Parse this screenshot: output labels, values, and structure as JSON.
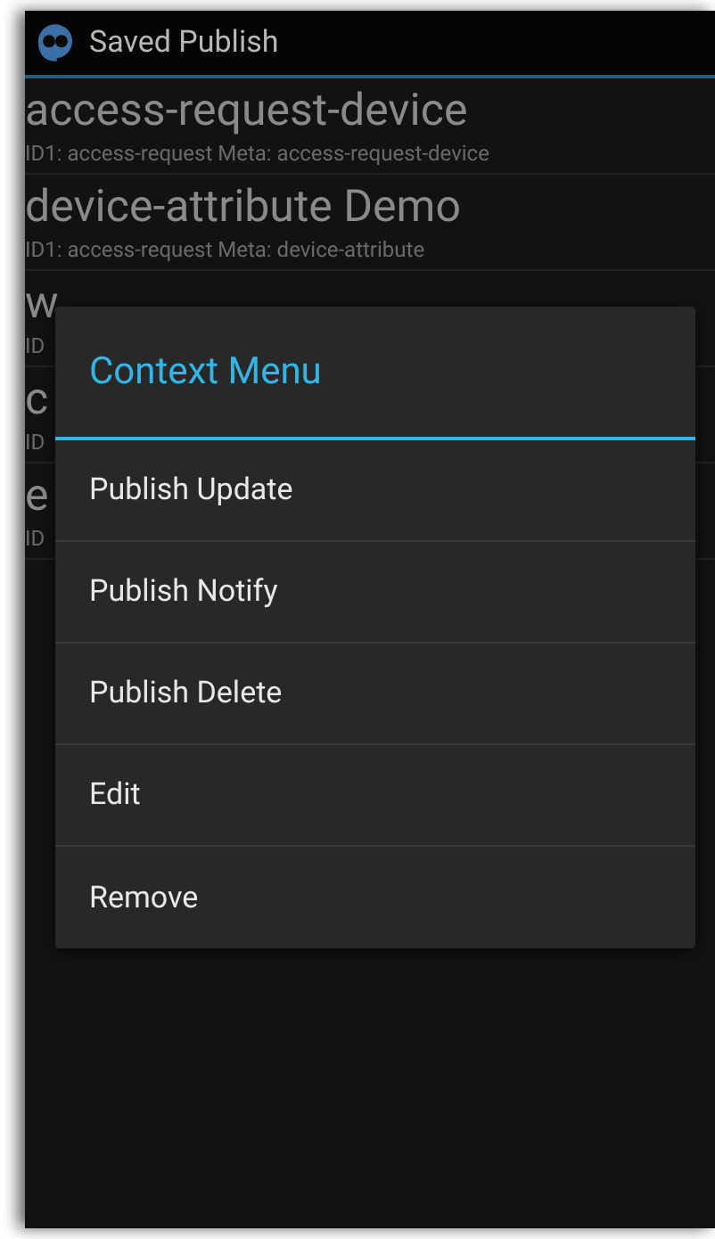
{
  "app_bar": {
    "title": "Saved Publish"
  },
  "list": [
    {
      "title": "access-request-device",
      "subtitle": "ID1: access-request Meta: access-request-device"
    },
    {
      "title": "device-attribute Demo",
      "subtitle": "ID1: access-request Meta: device-attribute"
    },
    {
      "title": "w",
      "subtitle": "ID"
    },
    {
      "title": "c",
      "subtitle": "ID"
    },
    {
      "title": "e",
      "subtitle": "ID"
    }
  ],
  "context_menu": {
    "title": "Context Menu",
    "items": [
      "Publish Update",
      "Publish Notify",
      "Publish Delete",
      "Edit",
      "Remove"
    ]
  }
}
